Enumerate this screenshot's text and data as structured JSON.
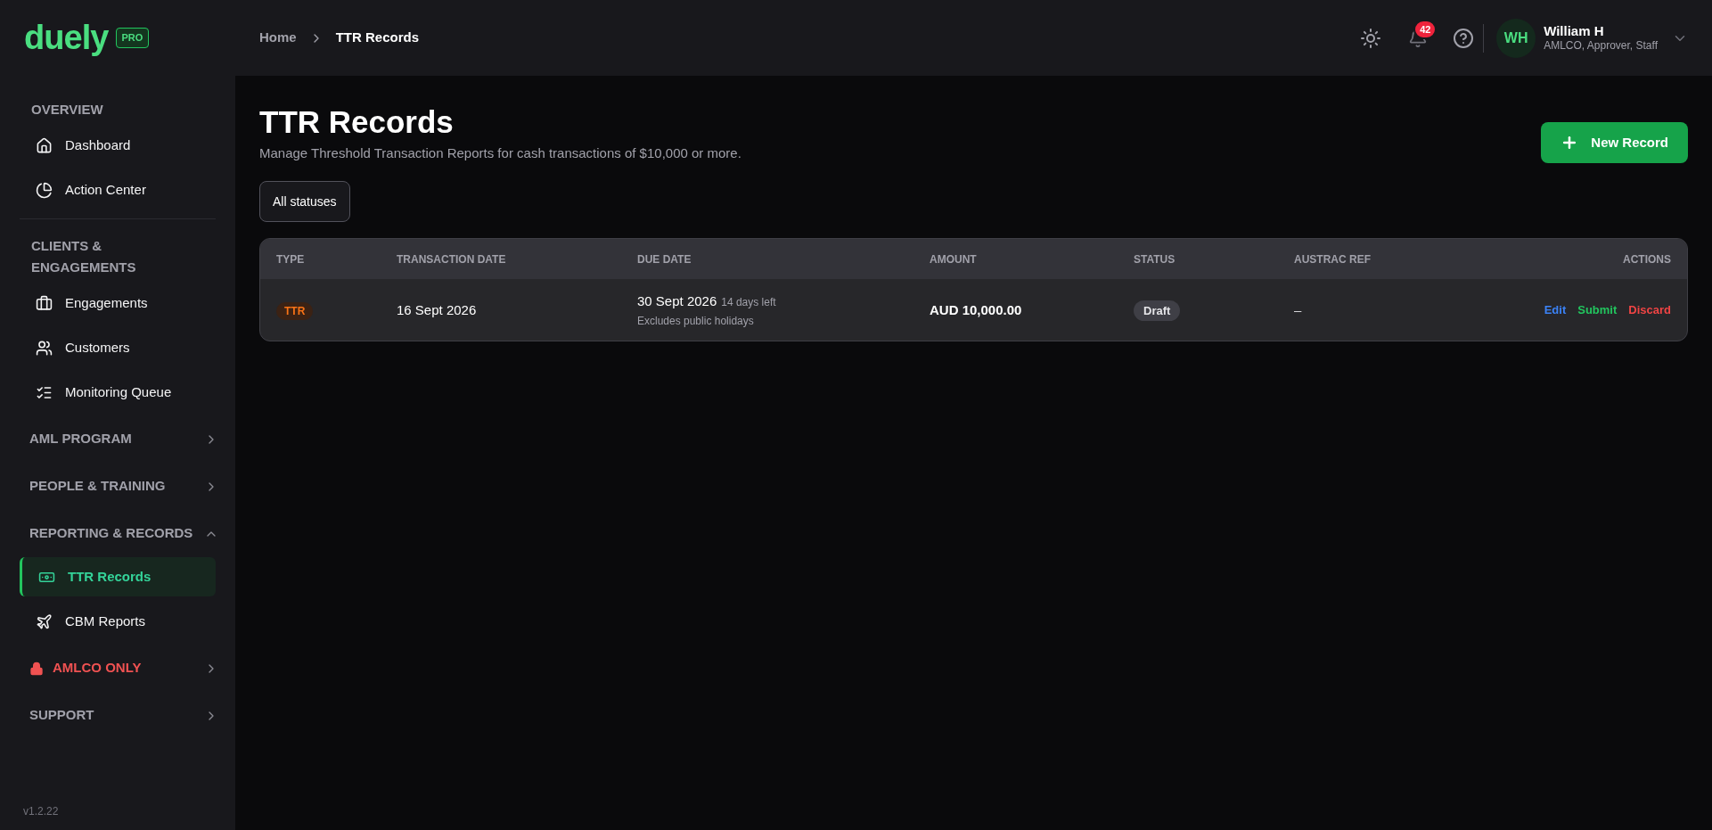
{
  "sidebar": {
    "logo": "duely",
    "badge": "PRO",
    "sections": [
      {
        "kind": "heading",
        "title": "OVERVIEW",
        "items": [
          {
            "label": "Dashboard",
            "selected": false
          },
          {
            "label": "Action Center",
            "selected": false
          }
        ]
      },
      {
        "kind": "heading",
        "title": "CLIENTS & ENGAGEMENTS",
        "items": [
          {
            "label": "Engagements",
            "selected": false
          },
          {
            "label": "Customers",
            "selected": false
          },
          {
            "label": "Monitoring Queue",
            "selected": false
          }
        ]
      },
      {
        "kind": "collapsible",
        "title": "AML PROGRAM",
        "expanded": false
      },
      {
        "kind": "collapsible",
        "title": "PEOPLE & TRAINING",
        "expanded": false
      },
      {
        "kind": "collapsible",
        "title": "REPORTING & RECORDS",
        "expanded": true,
        "items": [
          {
            "label": "TTR Records",
            "selected": true
          },
          {
            "label": "CBM Reports",
            "selected": false
          }
        ]
      },
      {
        "kind": "restricted",
        "title": "AMLCO ONLY",
        "expanded": false
      },
      {
        "kind": "collapsible",
        "title": "SUPPORT",
        "expanded": false
      }
    ],
    "version": "v1.2.22"
  },
  "header": {
    "breadcrumb": [
      "Home",
      "TTR Records"
    ],
    "notifications": "42",
    "user": {
      "initials": "WH",
      "name": "William H",
      "roles": "AMLCO, Approver, Staff"
    }
  },
  "page": {
    "title": "TTR Records",
    "subtitle": "Manage Threshold Transaction Reports for cash transactions of $10,000 or more.",
    "new_button": "New Record",
    "filter": "All statuses"
  },
  "table": {
    "columns": [
      "TYPE",
      "TRANSACTION DATE",
      "DUE DATE",
      "AMOUNT",
      "STATUS",
      "AUSTRAC REF",
      "ACTIONS"
    ],
    "rows": [
      {
        "type": "TTR",
        "transaction_date": "16 Sept 2026",
        "due_date": "30 Sept 2026",
        "days_left": "14 days left",
        "due_note": "Excludes public holidays",
        "amount": "AUD 10,000.00",
        "status": "Draft",
        "austrac_ref": "–",
        "actions": [
          {
            "kind": "edit",
            "label": "Edit"
          },
          {
            "kind": "submit",
            "label": "Submit"
          },
          {
            "kind": "discard",
            "label": "Discard"
          }
        ]
      }
    ]
  }
}
